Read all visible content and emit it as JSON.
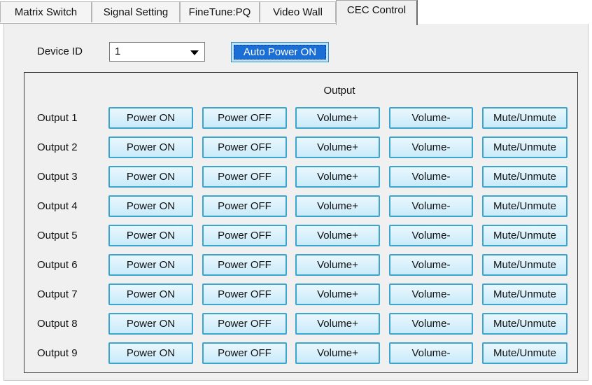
{
  "tabs": [
    {
      "label": "Matrix Switch",
      "active": false
    },
    {
      "label": "Signal Setting",
      "active": false
    },
    {
      "label": "FineTune:PQ",
      "active": false
    },
    {
      "label": "Video Wall",
      "active": false
    },
    {
      "label": "CEC Control",
      "active": true
    }
  ],
  "device": {
    "label": "Device ID",
    "selected": "1"
  },
  "auto_power_button": "Auto Power ON",
  "output_group": {
    "heading": "Output",
    "rows": [
      {
        "label": "Output 1"
      },
      {
        "label": "Output 2"
      },
      {
        "label": "Output 3"
      },
      {
        "label": "Output 4"
      },
      {
        "label": "Output 5"
      },
      {
        "label": "Output 6"
      },
      {
        "label": "Output 7"
      },
      {
        "label": "Output 8"
      },
      {
        "label": "Output 9"
      }
    ],
    "buttons": [
      "Power ON",
      "Power OFF",
      "Volume+",
      "Volume-",
      "Mute/Unmute"
    ]
  },
  "colors": {
    "panel_bg": "#f0f0f0",
    "button_border": "#3aa6cf",
    "button_fill": "#c9ebfa",
    "auto_power_fill": "#1a6fd6"
  }
}
